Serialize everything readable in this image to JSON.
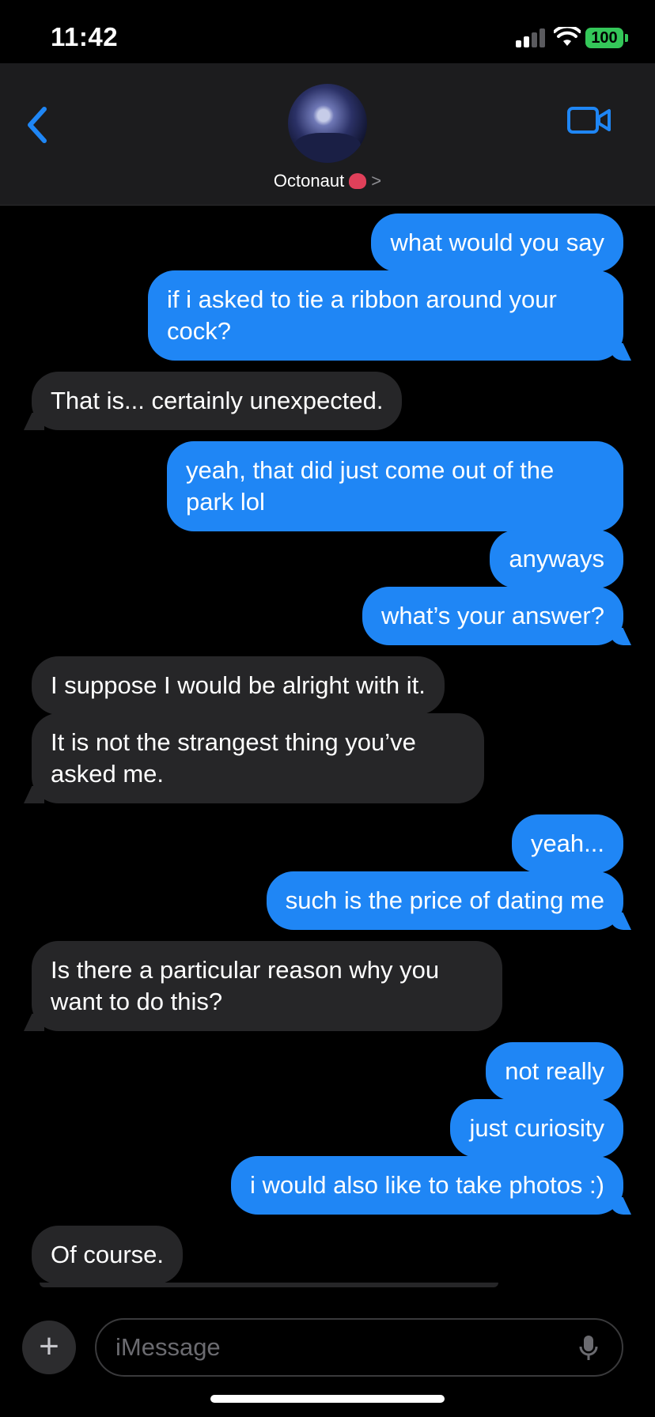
{
  "status_bar": {
    "time": "11:42",
    "battery": "100"
  },
  "header": {
    "contact_name": "Octonaut",
    "chevron": ">",
    "icons": {
      "back": "chevron-left-icon",
      "video": "video-call-icon",
      "avatar": "contact-avatar"
    },
    "accent_color": "#1f86f5"
  },
  "messages": [
    {
      "from": "me",
      "text": "what would you say"
    },
    {
      "from": "me",
      "text": "if i asked to tie a ribbon around your cock?"
    },
    {
      "from": "them",
      "text": "That is... certainly unexpected."
    },
    {
      "from": "me",
      "text": "yeah, that did just come out of the park lol"
    },
    {
      "from": "me",
      "text": "anyways"
    },
    {
      "from": "me",
      "text": "what’s your answer?"
    },
    {
      "from": "them",
      "text": "I suppose I would be alright with it."
    },
    {
      "from": "them",
      "text": "It is not the strangest thing you’ve asked me."
    },
    {
      "from": "me",
      "text": "yeah..."
    },
    {
      "from": "me",
      "text": "such is the price of dating me"
    },
    {
      "from": "them",
      "text": "Is there a particular reason why you want to do this?"
    },
    {
      "from": "me",
      "text": "not really"
    },
    {
      "from": "me",
      "text": "just curiosity"
    },
    {
      "from": "me",
      "text": "i would also like to take photos :)"
    },
    {
      "from": "them",
      "text": "Of course."
    }
  ],
  "input": {
    "placeholder": "iMessage",
    "plus_label": "+",
    "value": ""
  }
}
